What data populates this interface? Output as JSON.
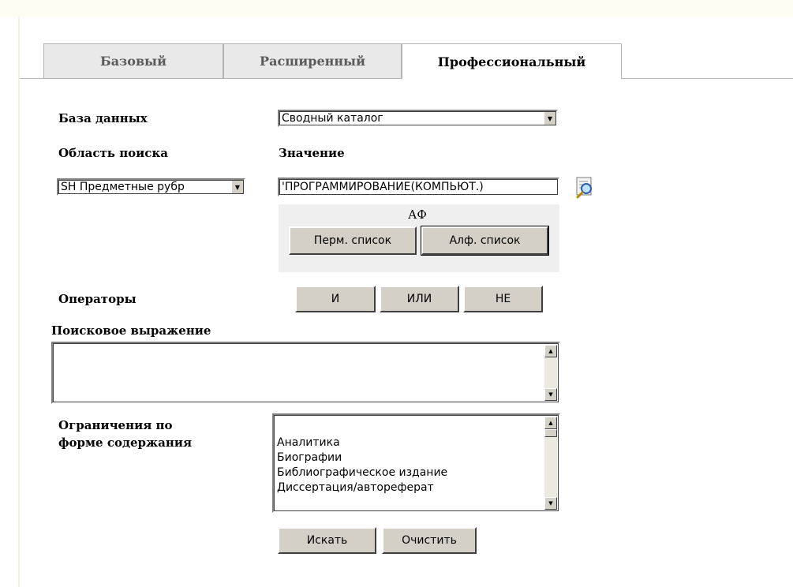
{
  "tabs": [
    {
      "label": "Базовый",
      "active": false
    },
    {
      "label": "Расширенный",
      "active": false
    },
    {
      "label": "Профессиональный",
      "active": true
    }
  ],
  "database": {
    "label": "База данных",
    "selected": "Сводный каталог"
  },
  "search_area": {
    "label": "Область поиска",
    "selected": "SH Предметные рубр"
  },
  "value": {
    "label": "Значение",
    "text": "'ПРОГРАММИРОВАНИЕ(КОМПЬЮТ.)"
  },
  "af_panel": {
    "title": "АФ",
    "perm_list": "Перм. список",
    "alf_list": "Алф. список"
  },
  "operators": {
    "label": "Операторы",
    "and": "И",
    "or": "ИЛИ",
    "not": "НЕ"
  },
  "expression": {
    "label": "Поисковое выражение",
    "text": ""
  },
  "restrictions": {
    "label_line1": "Ограничения по",
    "label_line2": "форме содержания",
    "items": [
      "Аналитика",
      "Биографии",
      "Библиографическое издание",
      "Диссертация/автореферат"
    ]
  },
  "actions": {
    "search": "Искать",
    "clear": "Очистить"
  },
  "icons": {
    "lookup": "magnifier-search-icon",
    "dropdown": "chevron-down-icon"
  }
}
